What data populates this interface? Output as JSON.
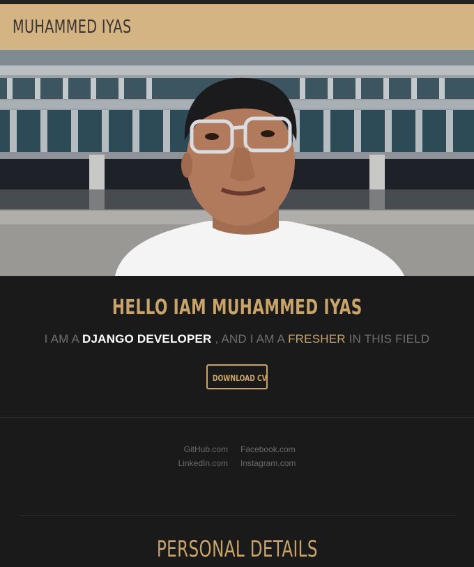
{
  "header": {
    "brand": "MUHAMMED IYAS"
  },
  "hero": {
    "image_alt": "Portrait photo in front of a building"
  },
  "intro": {
    "title": "HELLO IAM MUHAMMED IYAS",
    "line_prefix": "I AM A ",
    "line_role": "DJANGO DEVELOPER",
    "line_mid": " , AND I AM A ",
    "line_level": "FRESHER",
    "line_suffix": " IN THIS FIELD",
    "button_label": "DOWNLOAD CV"
  },
  "links": {
    "github": "GitHub.com",
    "facebook": "Facebook.com",
    "linkedin": "LinkedIn.com",
    "instagram": "Instagram.com"
  },
  "section": {
    "title": "PERSONAL DETAILS"
  },
  "colors": {
    "header_bg": "#d4b483",
    "accent": "#c9a46a",
    "page_bg": "#1a1a1a"
  }
}
